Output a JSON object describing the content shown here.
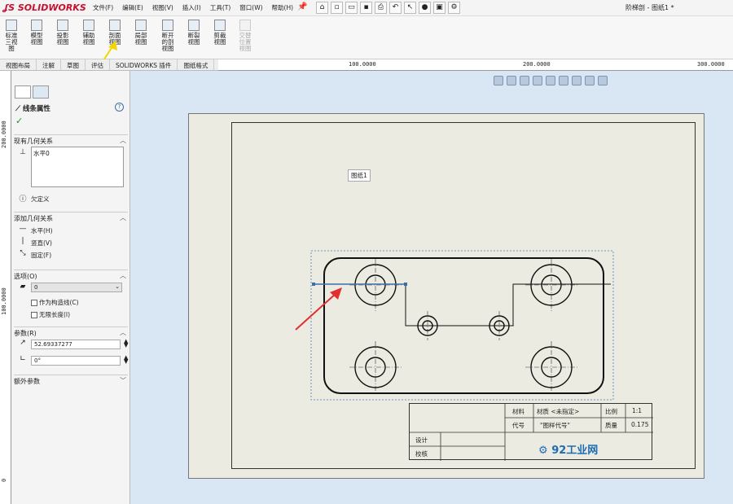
{
  "app": {
    "logo": "SOLIDWORKS",
    "doc_title": "阶梯剖 - 图纸1 *"
  },
  "menu": [
    "文件(F)",
    "编辑(E)",
    "视图(V)",
    "插入(I)",
    "工具(T)",
    "窗口(W)",
    "帮助(H)"
  ],
  "ribbon": [
    {
      "label": "标准三视图",
      "enabled": true
    },
    {
      "label": "模型视图",
      "enabled": true
    },
    {
      "label": "投影视图",
      "enabled": true
    },
    {
      "label": "辅助视图",
      "enabled": true
    },
    {
      "label": "剖面视图",
      "enabled": true
    },
    {
      "label": "局部视图",
      "enabled": true
    },
    {
      "label": "断开的剖视图",
      "enabled": true
    },
    {
      "label": "断裂视图",
      "enabled": true
    },
    {
      "label": "剪裁视图",
      "enabled": true
    },
    {
      "label": "交替位置视图",
      "enabled": false
    }
  ],
  "tabs": [
    "视图布局",
    "注解",
    "草图",
    "评估",
    "SOLIDWORKS 插件",
    "图纸格式"
  ],
  "ruler": {
    "top": [
      "100.0000",
      "200.0000",
      "300.0000"
    ],
    "left": [
      "200.0000",
      "100.0000",
      "0"
    ]
  },
  "panel": {
    "title": "线条属性",
    "existing_relations_label": "现有几何关系",
    "existing_relations": [
      "水平0"
    ],
    "status": "欠定义",
    "add_relations_label": "添加几何关系",
    "add_relations": [
      "水平(H)",
      "竖直(V)",
      "固定(F)"
    ],
    "options_label": "选项(O)",
    "options_value": "0",
    "construction": "作为构造线(C)",
    "infinite": "无限长度(I)",
    "params_label": "参数(R)",
    "length": "52.69337277",
    "angle": "0°",
    "extra_label": "额外参数"
  },
  "sheet": {
    "label": "图纸1"
  },
  "titleblock": {
    "material_label": "材料",
    "material_value": "材质 <未指定>",
    "scale_label": "比例",
    "scale_value": "1:1",
    "code_label": "代号",
    "code_value": "\"图样代号\"",
    "mass_label": "质量",
    "mass_value": "0.175",
    "design_label": "设计",
    "check_label": "校核",
    "brand": "92工业网"
  },
  "colors": {
    "accent": "#c8102e",
    "canvas": "#d9e7f5",
    "sheet": "#ecebe2",
    "selection": "#3b6ea8",
    "arrow": "#e03030"
  }
}
